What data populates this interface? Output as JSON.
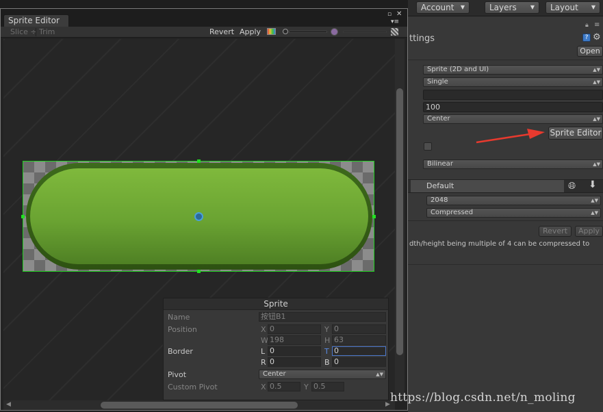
{
  "topbar": {
    "account": "Account",
    "layers": "Layers",
    "layout": "Layout"
  },
  "inspector": {
    "section_header": "ttings",
    "open_label": "Open",
    "texture_type": "Sprite (2D and UI)",
    "sprite_mode": "Single",
    "packing_tag": "",
    "pixels_per_unit": "100",
    "pivot": "Center",
    "sprite_editor_label": "Sprite Editor",
    "filter_mode": "Bilinear",
    "platform_label": "Default",
    "max_size": "2048",
    "format": "Compressed",
    "revert_label": "Revert",
    "apply_label": "Apply",
    "info_text": "dth/height being multiple of 4 can be compressed to"
  },
  "editor": {
    "tab_title": "Sprite Editor",
    "slice_label": "Slice",
    "trim_label": "Trim",
    "revert_label": "Revert",
    "apply_label": "Apply"
  },
  "sprite_panel": {
    "title": "Sprite",
    "name_label": "Name",
    "name_value": "按钮B1",
    "position_label": "Position",
    "x_label": "X",
    "x_value": "0",
    "y_label": "Y",
    "y_value": "0",
    "w_label": "W",
    "w_value": "198",
    "h_label": "H",
    "h_value": "63",
    "border_label": "Border",
    "l_label": "L",
    "l_value": "0",
    "t_label": "T",
    "t_value": "0",
    "r_label": "R",
    "r_value": "0",
    "b_label": "B",
    "b_value": "0",
    "pivot_label": "Pivot",
    "pivot_value": "Center",
    "custom_pivot_label": "Custom Pivot",
    "cx_label": "X",
    "cx_value": "0.5",
    "cy_label": "Y",
    "cy_value": "0.5"
  },
  "watermark": "https://blog.csdn.net/n_moling",
  "colors": {
    "accent_green": "#22d422",
    "arrow_red": "#e83a2e",
    "focus_blue": "#4d78cc"
  }
}
